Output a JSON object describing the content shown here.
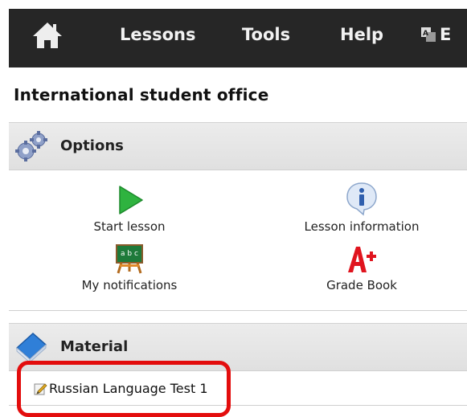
{
  "nav": {
    "home_icon": "home-icon",
    "items": [
      "Lessons",
      "Tools",
      "Help"
    ],
    "language_partial": "E"
  },
  "page": {
    "title": "International student office"
  },
  "options": {
    "header": "Options",
    "items": [
      {
        "label": "Start lesson",
        "icon": "play-icon"
      },
      {
        "label": "Lesson information",
        "icon": "info-icon"
      },
      {
        "label": "My notifications",
        "icon": "chalkboard-icon"
      },
      {
        "label": "Grade Book",
        "icon": "grade-a-plus-icon"
      }
    ]
  },
  "material": {
    "header": "Material",
    "items": [
      {
        "label": "Russian Language Test 1",
        "icon": "edit-document-icon"
      }
    ]
  },
  "colors": {
    "topbar": "#262626",
    "highlight": "#e30d0d",
    "play": "#2fb33f",
    "grade": "#e0141e"
  }
}
